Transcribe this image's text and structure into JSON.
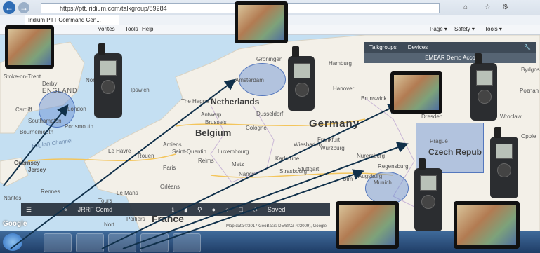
{
  "browser": {
    "address": "https://ptt.iridium.com/talkgroup/89284",
    "tab_title": "Iridium PTT Command Cen...",
    "menu": [
      "vorites",
      "Tools",
      "Help"
    ],
    "toolbar": [
      "Page ▾",
      "Safety ▾",
      "Tools ▾"
    ]
  },
  "panel": {
    "tabs": [
      "Talkgroups",
      "Devices"
    ],
    "account": "EMEAR Demo Acco"
  },
  "map": {
    "countries": [
      "Netherlands",
      "Belgium",
      "Germany",
      "Czech Repub",
      "France"
    ],
    "places": [
      "Stoke-on-Trent",
      "Derby",
      "Norwich",
      "ENGLAND",
      "Ipswich",
      "Cardiff",
      "London",
      "Southampton",
      "Portsmouth",
      "Bournemouth",
      "The Hague",
      "Antwerp",
      "Brussels",
      "Dusseldorf",
      "Cologne",
      "Groningen",
      "Amsterdam",
      "Hamburg",
      "Hanover",
      "Brunswick",
      "Frankfurt",
      "Wiesbaden",
      "Würzburg",
      "Luxembourg",
      "Nuremberg",
      "Regensburg",
      "Stuttgart",
      "Munich",
      "Ulm",
      "Augsburg",
      "Prague",
      "Dresden",
      "Wroclaw",
      "Paris",
      "Le Havre",
      "Rouen",
      "Amiens",
      "Saint-Quentin",
      "Reims",
      "Metz",
      "Nancy",
      "Strasbourg",
      "Karlsruhe",
      "Guernsey",
      "Jersey",
      "Rennes",
      "Le Mans",
      "Orléans",
      "Tours",
      "Nantes",
      "Poitiers",
      "Nort",
      "Bydgos",
      "Poznan",
      "Wroclaw",
      "Opole"
    ],
    "channel_label": "English Channel",
    "attribution": "Map data ©2017 GeoBasis-DE/BKG (©2009), Google",
    "logo": "Google"
  },
  "map_toolbar": {
    "group": "JRRF Comd",
    "status": "Saved"
  },
  "colors": {
    "water": "#c4dff2",
    "land": "#f3f0e8",
    "zone": "#648cd2",
    "panel": "#3e4a57",
    "arrow": "#10304a"
  }
}
